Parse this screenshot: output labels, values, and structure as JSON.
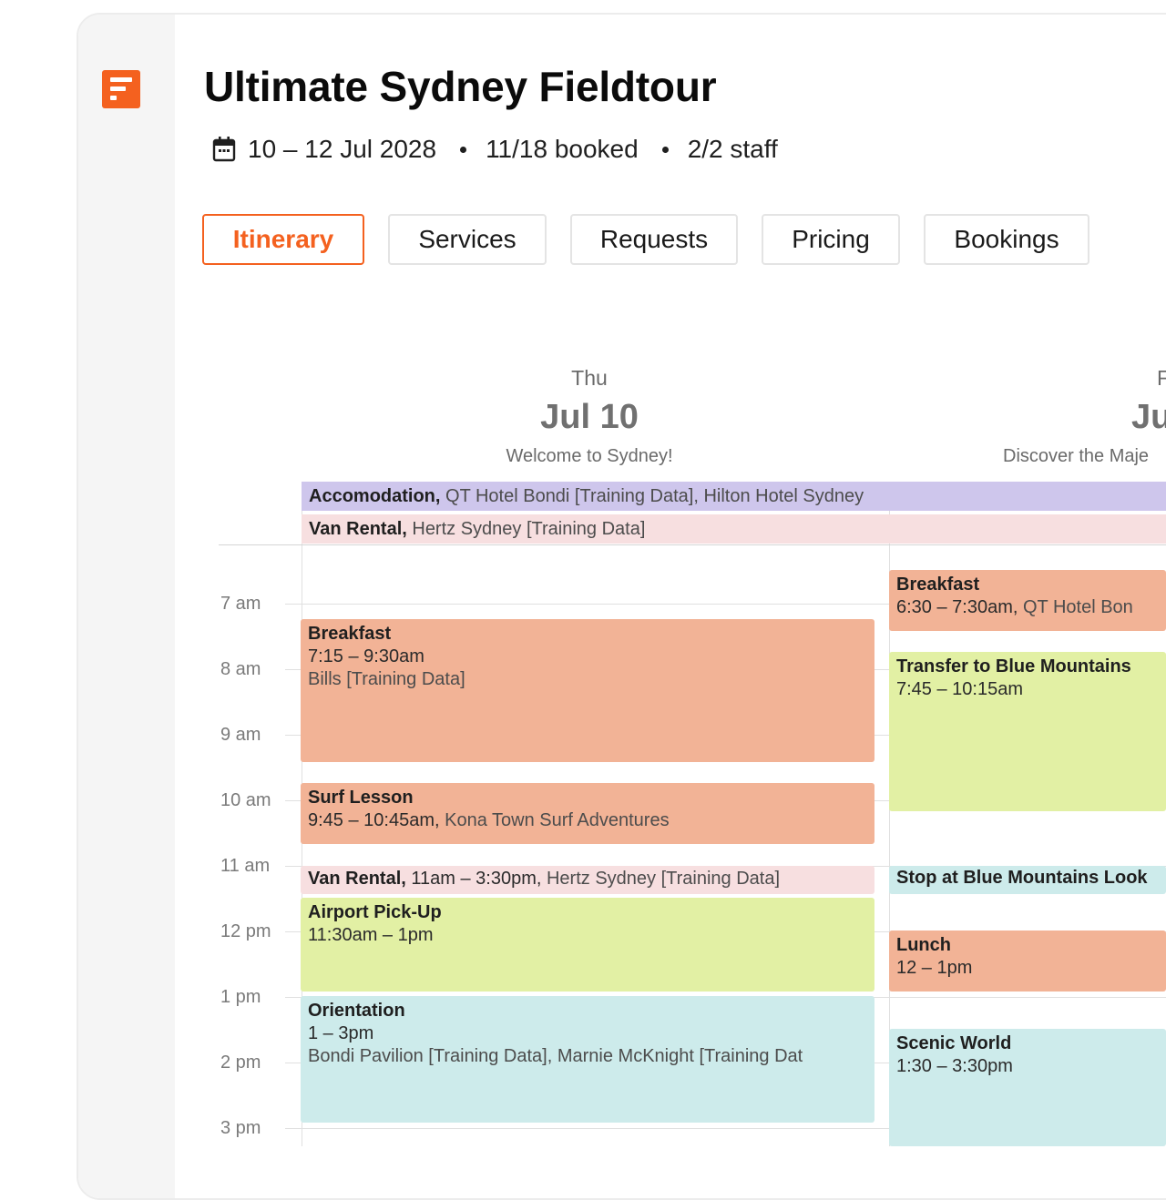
{
  "header": {
    "title": "Ultimate Sydney Fieldtour",
    "dates": "10 – 12 Jul 2028",
    "booked": "11/18 booked",
    "staff": "2/2 staff"
  },
  "tabs": [
    {
      "label": "Itinerary",
      "active": true
    },
    {
      "label": "Services",
      "active": false
    },
    {
      "label": "Requests",
      "active": false
    },
    {
      "label": "Pricing",
      "active": false
    },
    {
      "label": "Bookings",
      "active": false
    }
  ],
  "days": [
    {
      "weekday": "Thu",
      "date": "Jul 10",
      "subtitle": "Welcome to Sydney!"
    },
    {
      "weekday": "F",
      "date": "Ju",
      "subtitle": "Discover the Maje"
    }
  ],
  "all_day": [
    {
      "name": "Accomodation,",
      "detail": " QT Hotel Bondi [Training Data], Hilton Hotel Sydney",
      "color": "#cec6ec"
    },
    {
      "name": "Van Rental,",
      "detail": " Hertz Sydney [Training Data]",
      "color": "#f7dfe0"
    }
  ],
  "hours": [
    "7 am",
    "8 am",
    "9 am",
    "10 am",
    "11 am",
    "12 pm",
    "1 pm",
    "2 pm",
    "3 pm"
  ],
  "events": {
    "day1": {
      "breakfast": {
        "name": "Breakfast",
        "time": "7:15 – 9:30am",
        "place": "Bills [Training Data]"
      },
      "surf": {
        "name": "Surf Lesson",
        "time": "9:45 – 10:45am,",
        "place": " Kona Town Surf Adventures"
      },
      "van": {
        "name": "Van Rental,",
        "time": " 11am – 3:30pm,",
        "place": " Hertz Sydney [Training Data]"
      },
      "airport": {
        "name": "Airport Pick-Up",
        "time": "11:30am – 1pm"
      },
      "orientation": {
        "name": "Orientation",
        "time": "1 – 3pm",
        "place": "Bondi Pavilion [Training Data], Marnie McKnight [Training Dat"
      }
    },
    "day2": {
      "breakfast": {
        "name": "Breakfast",
        "time": "6:30 – 7:30am,",
        "place": " QT Hotel Bon"
      },
      "transfer": {
        "name": "Transfer to Blue Mountains",
        "time": "7:45 – 10:15am"
      },
      "lookout": {
        "name": "Stop at Blue Mountains Look"
      },
      "lunch": {
        "name": "Lunch",
        "time": "12 – 1pm"
      },
      "scenic": {
        "name": "Scenic World",
        "time": "1:30 – 3:30pm"
      }
    }
  },
  "colors": {
    "accent": "#f4611f",
    "meal": "#f2b396",
    "transfer": "#e2f0a4",
    "activity": "#cdebeb",
    "rental": "#f7dfe0",
    "accommodation": "#cec6ec"
  }
}
